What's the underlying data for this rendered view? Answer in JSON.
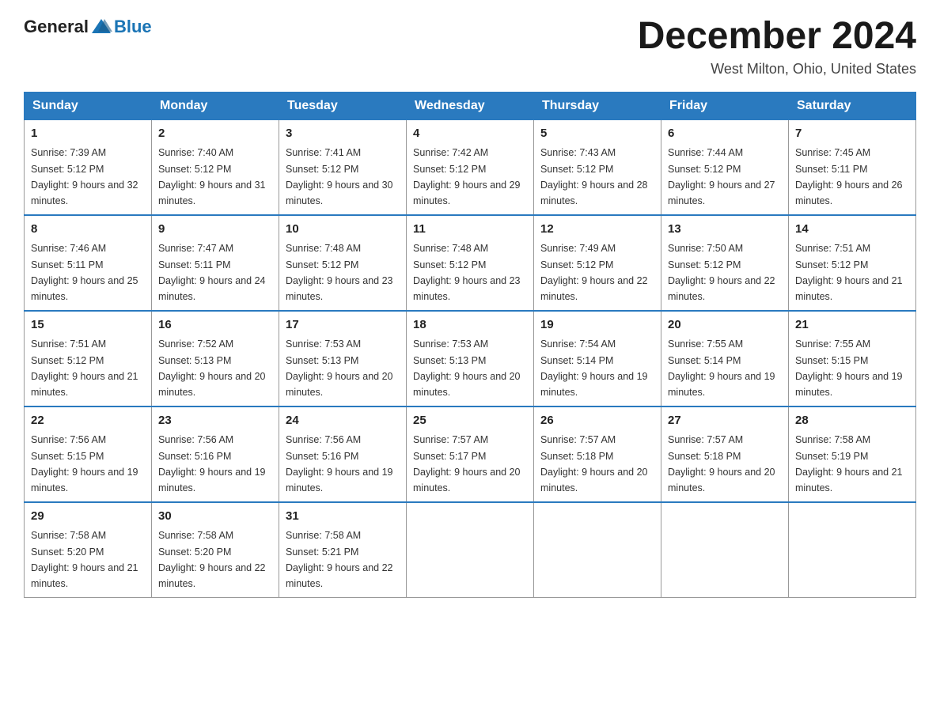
{
  "logo": {
    "general": "General",
    "blue": "Blue"
  },
  "title": "December 2024",
  "location": "West Milton, Ohio, United States",
  "days_of_week": [
    "Sunday",
    "Monday",
    "Tuesday",
    "Wednesday",
    "Thursday",
    "Friday",
    "Saturday"
  ],
  "weeks": [
    [
      {
        "day": "1",
        "sunrise": "7:39 AM",
        "sunset": "5:12 PM",
        "daylight": "9 hours and 32 minutes."
      },
      {
        "day": "2",
        "sunrise": "7:40 AM",
        "sunset": "5:12 PM",
        "daylight": "9 hours and 31 minutes."
      },
      {
        "day": "3",
        "sunrise": "7:41 AM",
        "sunset": "5:12 PM",
        "daylight": "9 hours and 30 minutes."
      },
      {
        "day": "4",
        "sunrise": "7:42 AM",
        "sunset": "5:12 PM",
        "daylight": "9 hours and 29 minutes."
      },
      {
        "day": "5",
        "sunrise": "7:43 AM",
        "sunset": "5:12 PM",
        "daylight": "9 hours and 28 minutes."
      },
      {
        "day": "6",
        "sunrise": "7:44 AM",
        "sunset": "5:12 PM",
        "daylight": "9 hours and 27 minutes."
      },
      {
        "day": "7",
        "sunrise": "7:45 AM",
        "sunset": "5:11 PM",
        "daylight": "9 hours and 26 minutes."
      }
    ],
    [
      {
        "day": "8",
        "sunrise": "7:46 AM",
        "sunset": "5:11 PM",
        "daylight": "9 hours and 25 minutes."
      },
      {
        "day": "9",
        "sunrise": "7:47 AM",
        "sunset": "5:11 PM",
        "daylight": "9 hours and 24 minutes."
      },
      {
        "day": "10",
        "sunrise": "7:48 AM",
        "sunset": "5:12 PM",
        "daylight": "9 hours and 23 minutes."
      },
      {
        "day": "11",
        "sunrise": "7:48 AM",
        "sunset": "5:12 PM",
        "daylight": "9 hours and 23 minutes."
      },
      {
        "day": "12",
        "sunrise": "7:49 AM",
        "sunset": "5:12 PM",
        "daylight": "9 hours and 22 minutes."
      },
      {
        "day": "13",
        "sunrise": "7:50 AM",
        "sunset": "5:12 PM",
        "daylight": "9 hours and 22 minutes."
      },
      {
        "day": "14",
        "sunrise": "7:51 AM",
        "sunset": "5:12 PM",
        "daylight": "9 hours and 21 minutes."
      }
    ],
    [
      {
        "day": "15",
        "sunrise": "7:51 AM",
        "sunset": "5:12 PM",
        "daylight": "9 hours and 21 minutes."
      },
      {
        "day": "16",
        "sunrise": "7:52 AM",
        "sunset": "5:13 PM",
        "daylight": "9 hours and 20 minutes."
      },
      {
        "day": "17",
        "sunrise": "7:53 AM",
        "sunset": "5:13 PM",
        "daylight": "9 hours and 20 minutes."
      },
      {
        "day": "18",
        "sunrise": "7:53 AM",
        "sunset": "5:13 PM",
        "daylight": "9 hours and 20 minutes."
      },
      {
        "day": "19",
        "sunrise": "7:54 AM",
        "sunset": "5:14 PM",
        "daylight": "9 hours and 19 minutes."
      },
      {
        "day": "20",
        "sunrise": "7:55 AM",
        "sunset": "5:14 PM",
        "daylight": "9 hours and 19 minutes."
      },
      {
        "day": "21",
        "sunrise": "7:55 AM",
        "sunset": "5:15 PM",
        "daylight": "9 hours and 19 minutes."
      }
    ],
    [
      {
        "day": "22",
        "sunrise": "7:56 AM",
        "sunset": "5:15 PM",
        "daylight": "9 hours and 19 minutes."
      },
      {
        "day": "23",
        "sunrise": "7:56 AM",
        "sunset": "5:16 PM",
        "daylight": "9 hours and 19 minutes."
      },
      {
        "day": "24",
        "sunrise": "7:56 AM",
        "sunset": "5:16 PM",
        "daylight": "9 hours and 19 minutes."
      },
      {
        "day": "25",
        "sunrise": "7:57 AM",
        "sunset": "5:17 PM",
        "daylight": "9 hours and 20 minutes."
      },
      {
        "day": "26",
        "sunrise": "7:57 AM",
        "sunset": "5:18 PM",
        "daylight": "9 hours and 20 minutes."
      },
      {
        "day": "27",
        "sunrise": "7:57 AM",
        "sunset": "5:18 PM",
        "daylight": "9 hours and 20 minutes."
      },
      {
        "day": "28",
        "sunrise": "7:58 AM",
        "sunset": "5:19 PM",
        "daylight": "9 hours and 21 minutes."
      }
    ],
    [
      {
        "day": "29",
        "sunrise": "7:58 AM",
        "sunset": "5:20 PM",
        "daylight": "9 hours and 21 minutes."
      },
      {
        "day": "30",
        "sunrise": "7:58 AM",
        "sunset": "5:20 PM",
        "daylight": "9 hours and 22 minutes."
      },
      {
        "day": "31",
        "sunrise": "7:58 AM",
        "sunset": "5:21 PM",
        "daylight": "9 hours and 22 minutes."
      },
      null,
      null,
      null,
      null
    ]
  ]
}
